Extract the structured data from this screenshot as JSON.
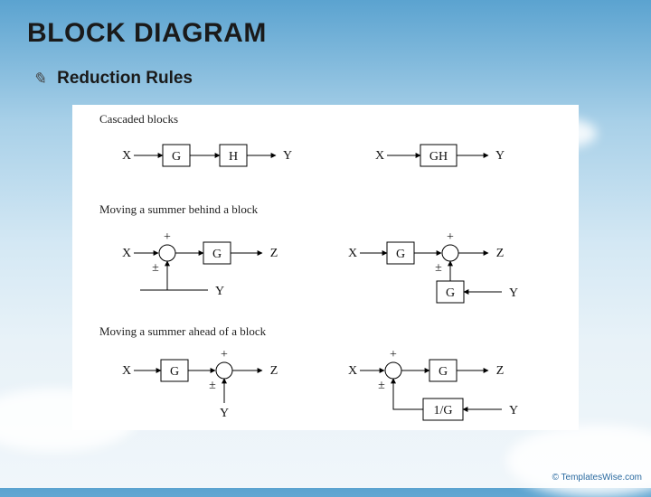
{
  "slide": {
    "title": "BLOCK DIAGRAM",
    "bullet": {
      "icon": "✎",
      "text": "Reduction Rules"
    },
    "watermark": "© TemplatesWise.com"
  },
  "figure": {
    "section1": {
      "caption": "Cascaded blocks",
      "left": {
        "X": "X",
        "G": "G",
        "H": "H",
        "Y": "Y"
      },
      "right": {
        "X": "X",
        "GH": "GH",
        "Y": "Y"
      }
    },
    "section2": {
      "caption": "Moving a summer behind a block",
      "left": {
        "X": "X",
        "G": "G",
        "Z": "Z",
        "Y": "Y",
        "plus": "+",
        "pm": "±"
      },
      "right": {
        "X": "X",
        "G": "G",
        "Z": "Z",
        "Y": "Y",
        "Gbox": "G",
        "plus": "+",
        "pm": "±"
      }
    },
    "section3": {
      "caption": "Moving a summer ahead of a block",
      "left": {
        "X": "X",
        "G": "G",
        "Z": "Z",
        "Y": "Y",
        "plus": "+",
        "pm": "±"
      },
      "right": {
        "X": "X",
        "G": "G",
        "Z": "Z",
        "Y": "Y",
        "invG": "1/G",
        "plus": "+",
        "pm": "±"
      }
    }
  }
}
